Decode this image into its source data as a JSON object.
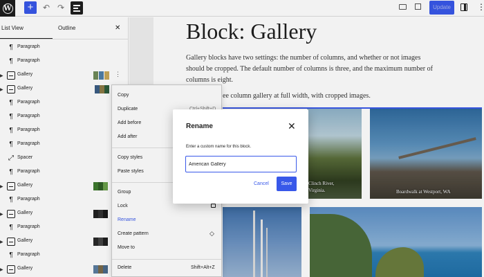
{
  "toolbar": {
    "wp_logo": "W",
    "add_icon": "+",
    "undo_icon": "↶",
    "redo_icon": "↷",
    "update_label": "Update",
    "accent": "#3858e9"
  },
  "sidebar": {
    "tab_listview": "List View",
    "tab_outline": "Outline",
    "close": "✕",
    "rows": [
      {
        "label": "Paragraph",
        "icon": "paragraph-icon"
      },
      {
        "label": "Paragraph",
        "icon": "paragraph-icon"
      },
      {
        "label": "Gallery",
        "icon": "gallery-icon"
      },
      {
        "label": "Gallery",
        "icon": "gallery-icon"
      },
      {
        "label": "Paragraph",
        "icon": "paragraph-icon"
      },
      {
        "label": "Paragraph",
        "icon": "paragraph-icon"
      },
      {
        "label": "Paragraph",
        "icon": "paragraph-icon"
      },
      {
        "label": "Paragraph",
        "icon": "paragraph-icon"
      },
      {
        "label": "Spacer",
        "icon": "spacer-icon"
      },
      {
        "label": "Paragraph",
        "icon": "paragraph-icon"
      },
      {
        "label": "Gallery",
        "icon": "gallery-icon"
      },
      {
        "label": "Paragraph",
        "icon": "paragraph-icon"
      },
      {
        "label": "Gallery",
        "icon": "gallery-icon"
      },
      {
        "label": "Paragraph",
        "icon": "paragraph-icon"
      },
      {
        "label": "Gallery",
        "icon": "gallery-icon"
      },
      {
        "label": "Paragraph",
        "icon": "paragraph-icon"
      },
      {
        "label": "Gallery",
        "icon": "gallery-icon"
      }
    ]
  },
  "editor": {
    "title": "Block: Gallery",
    "para1": "Gallery blocks have two settings: the number of columns, and whether or not images should be cropped. The default number of columns is three, and the maximum number of columns is eight.",
    "para2": "ee column gallery at full width, with cropped images.",
    "caption1": "Clinch River,",
    "caption1b": "Virginia.",
    "caption2": "Boardwalk at Westport, WA"
  },
  "context_menu": {
    "items": {
      "copy": "Copy",
      "duplicate": "Duplicate",
      "duplicate_shortcut": "Ctrl+Shift+D",
      "add_before": "Add before",
      "add_after": "Add after",
      "copy_styles": "Copy styles",
      "paste_styles": "Paste styles",
      "group": "Group",
      "lock": "Lock",
      "rename": "Rename",
      "create_pattern": "Create pattern",
      "move_to": "Move to",
      "delete": "Delete",
      "delete_shortcut": "Shift+Alt+Z"
    }
  },
  "modal": {
    "title": "Rename",
    "help": "Enter a custom name for this block.",
    "input_value": "American Gallery",
    "cancel": "Cancel",
    "save": "Save",
    "close": "✕"
  }
}
